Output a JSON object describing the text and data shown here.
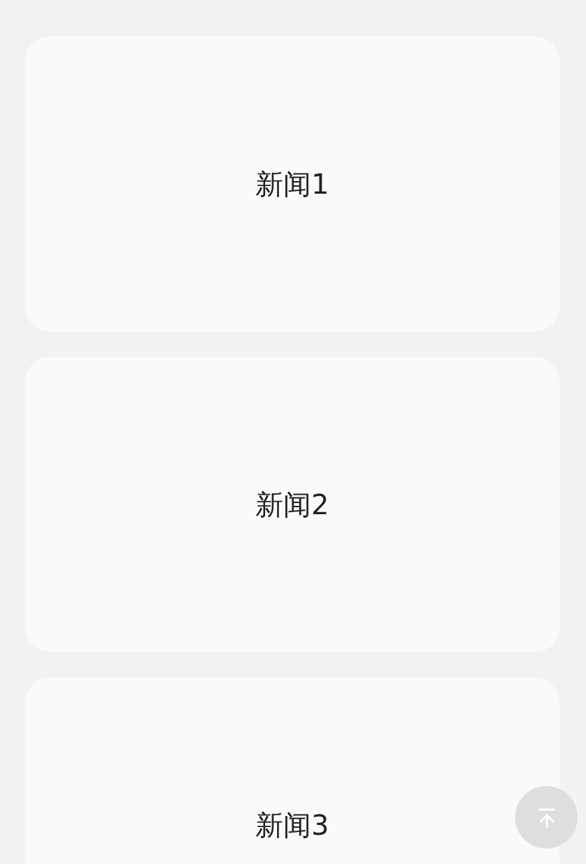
{
  "news_cards": [
    {
      "title": "新闻1"
    },
    {
      "title": "新闻2"
    },
    {
      "title": "新闻3"
    }
  ]
}
